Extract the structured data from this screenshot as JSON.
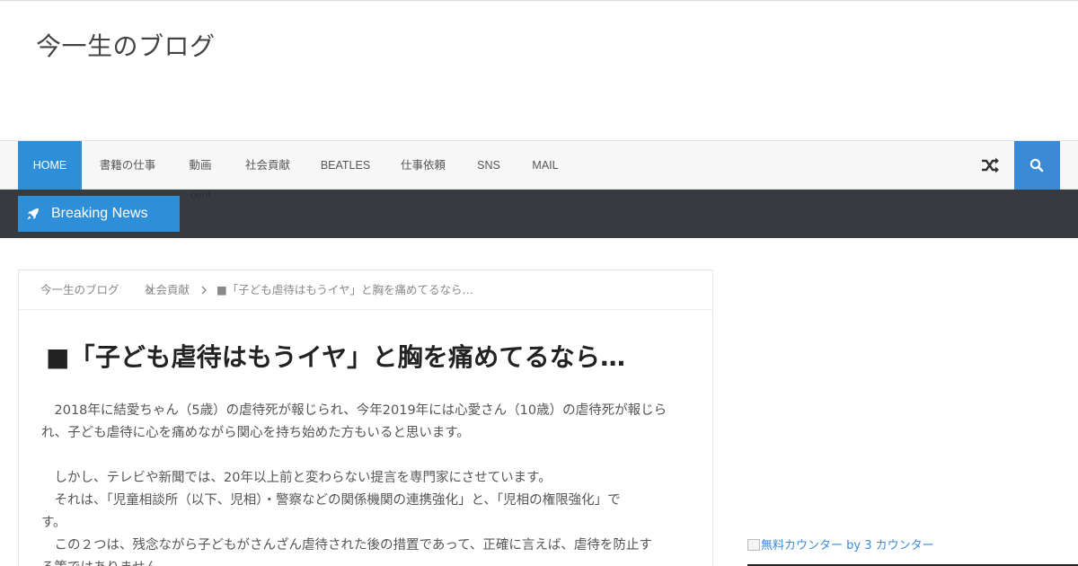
{
  "site": {
    "title": "今一生のブログ"
  },
  "nav": {
    "items": [
      {
        "label": "HOME",
        "active": true
      },
      {
        "label": "書籍の仕事",
        "active": false
      },
      {
        "label": "動画",
        "active": false
      },
      {
        "label": "社会貢献",
        "active": false
      },
      {
        "label": "BEATLES",
        "active": false
      },
      {
        "label": "仕事依頼",
        "active": false
      },
      {
        "label": "SNS",
        "active": false
      },
      {
        "label": "MAIL",
        "active": false
      }
    ],
    "random_icon": "shuffle-icon",
    "search_icon": "search-icon",
    "accent_color": "#2e8fd9"
  },
  "ticker": {
    "label": "Breaking News",
    "icon": "rocket-icon",
    "ghost_text": "cent"
  },
  "breadcrumb": {
    "items": [
      "今一生のブログ",
      "社会貢献",
      "■「子ども虐待はもうイヤ」と胸を痛めてるなら…"
    ]
  },
  "post": {
    "title": "■「子ども虐待はもうイヤ」と胸を痛めてるなら…",
    "paragraphs": [
      [
        "　2018年に結愛ちゃん（5歳）の虐待死が報じられ、今年2019年には心愛さん（10歳）の虐待死が報じら",
        "れ、子ども虐待に心を痛めながら関心を持ち始めた方もいると思います。"
      ],
      [
        "　しかし、テレビや新聞では、20年以上前と変わらない提言を専門家にさせています。",
        "　それは、「児童相談所（以下、児相）・警察などの関係機関の連携強化」と、「児相の権限強化」で",
        "す。",
        "　この２つは、残念ながら子どもがさんざん虐待された後の措置であって、正確に言えば、虐待を防止す",
        "る策ではありません。"
      ]
    ]
  },
  "sidebar": {
    "counter_text": "無料カウンター by 3 カウンター"
  }
}
